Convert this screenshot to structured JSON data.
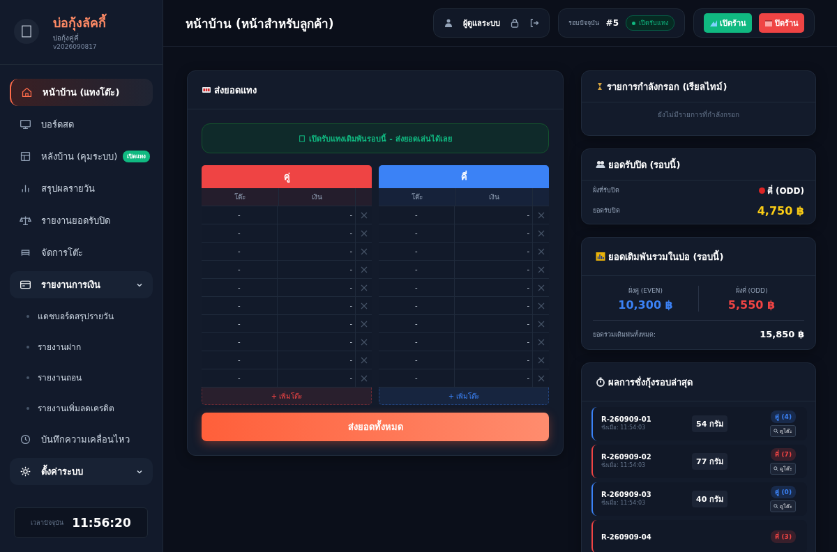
{
  "brand": {
    "name": "บ่อกุ้งลัคกี้",
    "subtitle": "บ่อกุ้งคู่คี่",
    "version": "v2026090817"
  },
  "sidebar": {
    "items": [
      {
        "kind": "item",
        "label": "หน้าบ้าน (แทงโต๊ะ)",
        "selected": true
      },
      {
        "kind": "item",
        "label": "บอร์ดสด",
        "selected": false
      },
      {
        "kind": "item",
        "label": "หลังบ้าน (คุมระบบ)",
        "selected": false,
        "badge": "เปิดแทง"
      },
      {
        "kind": "item",
        "label": "สรุปผลรายวัน",
        "selected": false
      },
      {
        "kind": "item",
        "label": "รายงานยอดรับปิด",
        "selected": false
      },
      {
        "kind": "item",
        "label": "จัดการโต๊ะ",
        "selected": false
      },
      {
        "kind": "group",
        "label": "รายงานการเงิน",
        "expanded": true,
        "children": [
          {
            "label": "แดชบอร์ดสรุปรายวัน"
          },
          {
            "label": "รายงานฝาก"
          },
          {
            "label": "รายงานถอน"
          },
          {
            "label": "รายงานเพิ่มลดเครดิต"
          }
        ]
      },
      {
        "kind": "item",
        "label": "บันทึกความเคลื่อนไหว",
        "selected": false
      },
      {
        "kind": "group",
        "label": "ตั้งค่าระบบ",
        "expanded": true
      }
    ]
  },
  "clock": {
    "label": "เวลาปัจจุบัน",
    "time": "11:56:20"
  },
  "header": {
    "title": "หน้าบ้าน (หน้าสำหรับลูกค้า)",
    "user": "ผู้ดูแลระบบ",
    "round_label": "รอบปัจจุบัน",
    "round_number": "#5",
    "round_status": "เปิดรับแทง",
    "buttons": [
      {
        "label": "เปิดร้าน",
        "kind": "open"
      },
      {
        "label": "ปิดร้าน",
        "kind": "close"
      }
    ]
  },
  "bet_panel": {
    "title": "ส่งยอดแทง",
    "notice": "เปิดรับแทงเดิมพันรอบนี้ - ส่งยอดเล่นได้เลย",
    "submit": "ส่งยอดทั้งหมด",
    "sides": [
      {
        "label": "คู่",
        "color": "#ef4444",
        "columns": [
          "โต๊ะ",
          "เงิน"
        ],
        "add_label": "+ เพิ่มโต๊ะ",
        "rows": [
          {
            "table": "-",
            "amount": "-"
          },
          {
            "table": "-",
            "amount": "-"
          },
          {
            "table": "-",
            "amount": "-"
          },
          {
            "table": "-",
            "amount": "-"
          },
          {
            "table": "-",
            "amount": "-"
          },
          {
            "table": "-",
            "amount": "-"
          },
          {
            "table": "-",
            "amount": "-"
          },
          {
            "table": "-",
            "amount": "-"
          },
          {
            "table": "-",
            "amount": "-"
          },
          {
            "table": "-",
            "amount": "-"
          }
        ]
      },
      {
        "label": "คี่",
        "color": "#3b82f6",
        "columns": [
          "โต๊ะ",
          "เงิน"
        ],
        "add_label": "+ เพิ่มโต๊ะ",
        "rows": [
          {
            "table": "-",
            "amount": "-"
          },
          {
            "table": "-",
            "amount": "-"
          },
          {
            "table": "-",
            "amount": "-"
          },
          {
            "table": "-",
            "amount": "-"
          },
          {
            "table": "-",
            "amount": "-"
          },
          {
            "table": "-",
            "amount": "-"
          },
          {
            "table": "-",
            "amount": "-"
          },
          {
            "table": "-",
            "amount": "-"
          },
          {
            "table": "-",
            "amount": "-"
          },
          {
            "table": "-",
            "amount": "-"
          }
        ]
      }
    ]
  },
  "pending": {
    "title": "รายการกำลังกรอก (เรียลไทม์)",
    "empty": "ยังไม่มีรายการที่กำลังกรอก"
  },
  "close_bet": {
    "title": "ยอดรับปิด (รอบนี้)",
    "side_label": "ฝั่งที่รับปิด",
    "side_value": "คี่ (ODD)",
    "color": "#dc2626",
    "amount_label": "ยอดรับปิด",
    "amount_value": "4,750 ฿"
  },
  "totals": {
    "title": "ยอดเดิมพันรวมในบ่อ (รอบนี้)",
    "sides": [
      {
        "label": "ฝั่งคู่ (EVEN)",
        "value": "10,300 ฿",
        "color": "#3b82f6"
      },
      {
        "label": "ฝั่งคี่ (ODD)",
        "value": "5,550 ฿",
        "color": "#ef4444"
      }
    ],
    "total_label": "ยอดรวมเดิมพันทั้งหมด:",
    "total_value": "15,850 ฿"
  },
  "results": {
    "title": "ผลการชั่งกุ้งรอบล่าสุด",
    "items": [
      {
        "id": "R-260909-01",
        "time": "ชั่งเมื่อ: 11:54:03",
        "weight": "54 กรัม",
        "result": "คู่ (4)",
        "color": "#3b82f6",
        "view": "ดูโต๊ะ"
      },
      {
        "id": "R-260909-02",
        "time": "ชั่งเมื่อ: 11:54:03",
        "weight": "77 กรัม",
        "result": "คี่ (7)",
        "color": "#ef4444",
        "view": "ดูโต๊ะ"
      },
      {
        "id": "R-260909-03",
        "time": "ชั่งเมื่อ: 11:54:03",
        "weight": "40 กรัม",
        "result": "คู่ (0)",
        "color": "#3b82f6",
        "view": "ดูโต๊ะ"
      },
      {
        "id": "R-260909-04",
        "result": "คี่ (3)",
        "color": "#ef4444"
      }
    ]
  }
}
